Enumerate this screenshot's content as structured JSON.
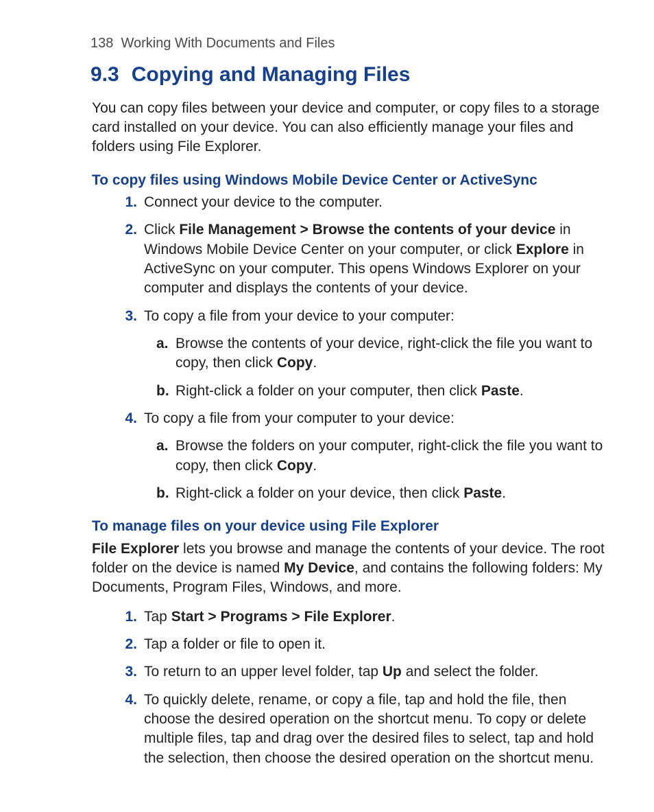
{
  "header": {
    "page_number": "138",
    "chapter_title": "Working With Documents and Files"
  },
  "section": {
    "number": "9.3",
    "title": "Copying and Managing Files",
    "intro": "You can copy files between your device and computer, or copy files to a storage card installed on your device. You can also efficiently manage your files and folders using File Explorer."
  },
  "proc1": {
    "heading": "To copy files using Windows Mobile Device Center or ActiveSync",
    "items": [
      {
        "n": "1.",
        "text": "Connect your device to the computer."
      },
      {
        "n": "2.",
        "pre": "Click ",
        "b1": "File Management > Browse the contents of your device",
        "mid1": " in Windows Mobile Device Center on your computer, or click ",
        "b2": "Explore",
        "tail": " in ActiveSync on your computer. This opens Windows Explorer on your computer and displays the contents of your device."
      },
      {
        "n": "3.",
        "text": "To copy a file from your device to your computer:",
        "sub": [
          {
            "l": "a.",
            "pre": "Browse the contents of your device, right-click the file you want to copy, then click ",
            "b": "Copy",
            "post": "."
          },
          {
            "l": "b.",
            "pre": "Right-click a folder on your computer, then click ",
            "b": "Paste",
            "post": "."
          }
        ]
      },
      {
        "n": "4.",
        "text": "To copy a file from your computer to your device:",
        "sub": [
          {
            "l": "a.",
            "pre": "Browse the folders on your computer, right-click the file you want to copy, then click ",
            "b": "Copy",
            "post": "."
          },
          {
            "l": "b.",
            "pre": "Right-click a folder on your device, then click ",
            "b": "Paste",
            "post": "."
          }
        ]
      }
    ]
  },
  "proc2": {
    "heading": "To manage files on your device using File Explorer",
    "intro": {
      "b1": "File Explorer",
      "mid1": " lets you browse and manage the contents of your device. The root folder on the device is named ",
      "b2": "My Device",
      "tail": ", and contains the following folders: My Documents, Program Files, Windows, and more."
    },
    "items": [
      {
        "n": "1.",
        "pre": "Tap ",
        "b": "Start > Programs > File Explorer",
        "post": "."
      },
      {
        "n": "2.",
        "text": "Tap a folder or file to open it."
      },
      {
        "n": "3.",
        "pre": "To return to an upper level folder, tap ",
        "b": "Up",
        "post": " and select the folder."
      },
      {
        "n": "4.",
        "text": "To quickly delete, rename, or copy a file, tap and hold the file, then choose the desired operation on the shortcut menu. To copy or delete multiple files, tap and drag over the desired files to select, tap and hold the selection, then choose the desired operation on the shortcut menu."
      }
    ]
  }
}
